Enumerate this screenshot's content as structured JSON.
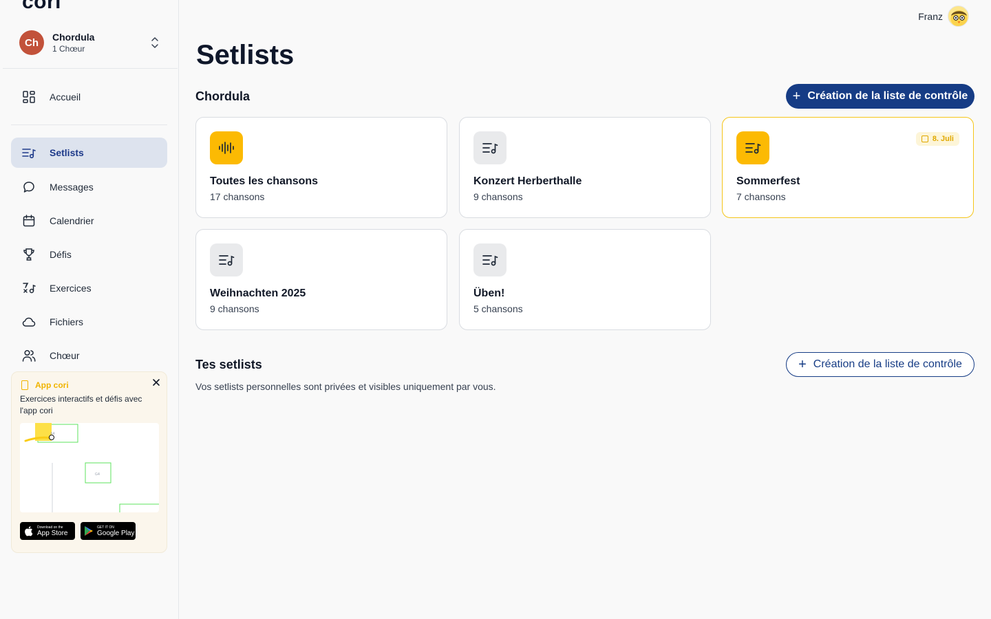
{
  "app": {
    "logo": "cori"
  },
  "choir": {
    "initials": "Ch",
    "name": "Chordula",
    "subtitle": "1 Chœur"
  },
  "nav": {
    "home": "Accueil",
    "items": [
      {
        "label": "Setlists",
        "icon": "setlist-icon",
        "active": true
      },
      {
        "label": "Messages",
        "icon": "chat-bubble-icon"
      },
      {
        "label": "Calendrier",
        "icon": "calendar-icon"
      },
      {
        "label": "Défis",
        "icon": "trophy-icon"
      },
      {
        "label": "Exercices",
        "icon": "exercise-icon"
      },
      {
        "label": "Fichiers",
        "icon": "cloud-icon"
      },
      {
        "label": "Chœur",
        "icon": "users-icon"
      }
    ]
  },
  "promo": {
    "title": "App cori",
    "text": "Exercices interactifs et défis avec l'app cori",
    "preview_labels": [
      "A4",
      "G4"
    ],
    "app_store": {
      "small": "Download on the",
      "big": "App Store"
    },
    "google_play": {
      "small": "GET IT ON",
      "big": "Google Play"
    }
  },
  "user": {
    "name": "Franz"
  },
  "page": {
    "title": "Setlists"
  },
  "choir_section": {
    "title": "Chordula",
    "create_label": "Création de la liste de contrôle",
    "cards": [
      {
        "title": "Toutes les chansons",
        "count": "17 chansons",
        "icon": "waveform-icon",
        "yellow": true
      },
      {
        "title": "Konzert Herberthalle",
        "count": "9 chansons",
        "icon": "setlist-icon"
      },
      {
        "title": "Sommerfest",
        "count": "7 chansons",
        "icon": "setlist-icon",
        "yellow": true,
        "date": "8. Juli"
      },
      {
        "title": "Weihnachten 2025",
        "count": "9 chansons",
        "icon": "setlist-icon"
      },
      {
        "title": "Üben!",
        "count": "5 chansons",
        "icon": "setlist-icon"
      }
    ]
  },
  "personal_section": {
    "title": "Tes setlists",
    "create_label": "Création de la liste de contrôle",
    "description": "Vos setlists personnelles sont privées et visibles uniquement par vous."
  },
  "colors": {
    "primary": "#163c85",
    "accent": "#fcba03",
    "avatar": "#c2523a"
  }
}
